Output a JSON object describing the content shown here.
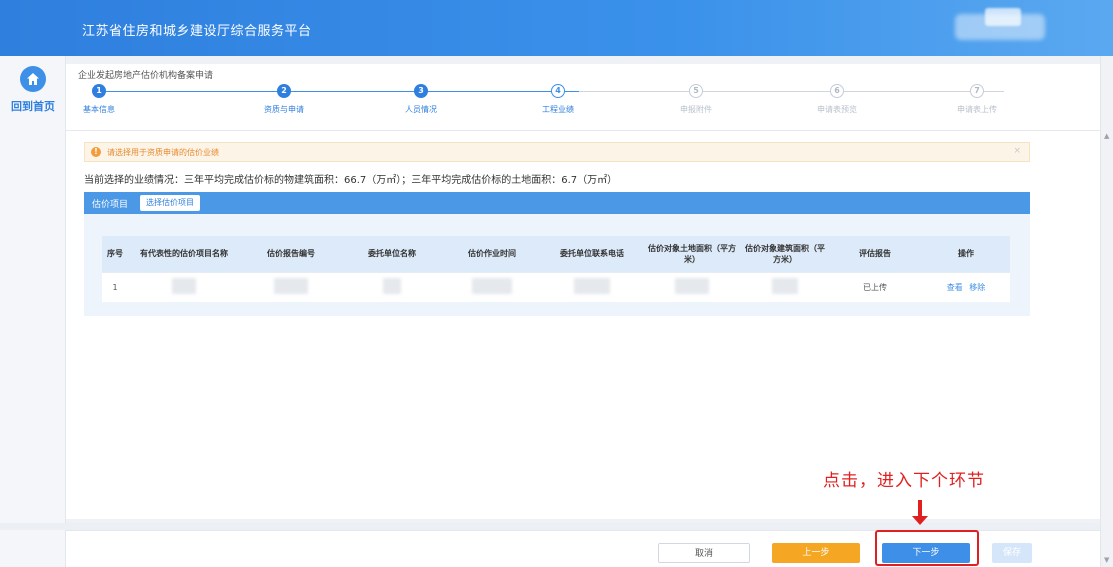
{
  "header": {
    "title": "江苏省住房和城乡建设厅综合服务平台"
  },
  "sidebar": {
    "home_label": "回到首页"
  },
  "breadcrumb": "企业发起房地产估价机构备案申请",
  "steps": [
    {
      "num": "1",
      "label": "基本信息",
      "state": "done"
    },
    {
      "num": "2",
      "label": "资质与申请",
      "state": "done"
    },
    {
      "num": "3",
      "label": "人员情况",
      "state": "done"
    },
    {
      "num": "4",
      "label": "工程业绩",
      "state": "current"
    },
    {
      "num": "5",
      "label": "申报附件",
      "state": "todo"
    },
    {
      "num": "6",
      "label": "申请表预览",
      "state": "todo"
    },
    {
      "num": "7",
      "label": "申请表上传",
      "state": "todo"
    }
  ],
  "alert": {
    "text": "请选择用于资质申请的估价业绩",
    "close": "×"
  },
  "summary": "当前选择的业绩情况：三年平均完成估价标的物建筑面积：66.7（万㎡）；三年平均完成估价标的土地面积：6.7（万㎡）",
  "section": {
    "title": "估价项目",
    "select_button": "选择估价项目"
  },
  "table": {
    "headers": [
      "序号",
      "有代表性的估价项目名称",
      "估价报告编号",
      "委托单位名称",
      "估价作业时间",
      "委托单位联系电话",
      "估价对象土地面积（平方米）",
      "估价对象建筑面积（平方米）",
      "评估报告",
      "操作"
    ],
    "rows": [
      {
        "index": "1",
        "report_status": "已上传",
        "action_view": "查看",
        "action_remove": "移除"
      }
    ]
  },
  "annotation": {
    "text": "点击，进入下个环节"
  },
  "footer": {
    "cancel": "取消",
    "prev": "上一步",
    "next": "下一步",
    "save": "保存"
  },
  "colors": {
    "primary": "#3d8fe8",
    "warning": "#f5a623",
    "annotation": "#e02020"
  }
}
